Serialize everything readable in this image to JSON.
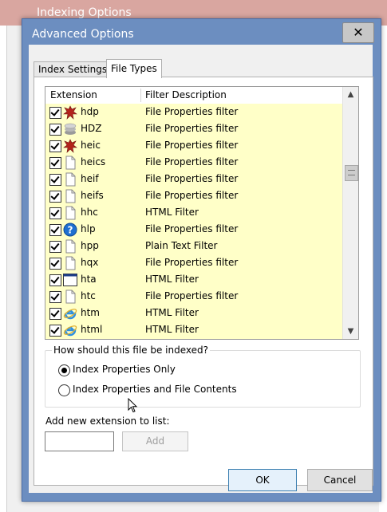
{
  "background_window": {
    "title": "Indexing Options"
  },
  "dialog": {
    "title": "Advanced Options",
    "close_glyph": "✕",
    "tabs": [
      {
        "label": "Index Settings",
        "active": false
      },
      {
        "label": "File Types",
        "active": true
      }
    ],
    "list": {
      "headers": {
        "extension": "Extension",
        "filter": "Filter Description"
      },
      "rows": [
        {
          "ext": "hdp",
          "desc": "File Properties filter",
          "icon": "red-splat-icon",
          "checked": true
        },
        {
          "ext": "HDZ",
          "desc": "File Properties filter",
          "icon": "stack-icon",
          "checked": true
        },
        {
          "ext": "heic",
          "desc": "File Properties filter",
          "icon": "red-splat-icon",
          "checked": true
        },
        {
          "ext": "heics",
          "desc": "File Properties filter",
          "icon": "blank-file-icon",
          "checked": true
        },
        {
          "ext": "heif",
          "desc": "File Properties filter",
          "icon": "blank-file-icon",
          "checked": true
        },
        {
          "ext": "heifs",
          "desc": "File Properties filter",
          "icon": "blank-file-icon",
          "checked": true
        },
        {
          "ext": "hhc",
          "desc": "HTML Filter",
          "icon": "blank-file-icon",
          "checked": true
        },
        {
          "ext": "hlp",
          "desc": "File Properties filter",
          "icon": "help-icon",
          "checked": true
        },
        {
          "ext": "hpp",
          "desc": "Plain Text Filter",
          "icon": "blank-file-icon",
          "checked": true
        },
        {
          "ext": "hqx",
          "desc": "File Properties filter",
          "icon": "blank-file-icon",
          "checked": true
        },
        {
          "ext": "hta",
          "desc": "HTML Filter",
          "icon": "window-icon",
          "checked": true
        },
        {
          "ext": "htc",
          "desc": "File Properties filter",
          "icon": "blank-file-icon",
          "checked": true
        },
        {
          "ext": "htm",
          "desc": "HTML Filter",
          "icon": "ie-icon",
          "checked": true
        },
        {
          "ext": "html",
          "desc": "HTML Filter",
          "icon": "ie-icon",
          "checked": true
        }
      ]
    },
    "index_group": {
      "label": "How should this file be indexed?",
      "options": [
        {
          "label": "Index Properties Only",
          "selected": true
        },
        {
          "label": "Index Properties and File Contents",
          "selected": false
        }
      ]
    },
    "add_extension": {
      "label": "Add new extension to list:",
      "value": "",
      "button": "Add"
    },
    "buttons": {
      "ok": "OK",
      "cancel": "Cancel"
    }
  }
}
